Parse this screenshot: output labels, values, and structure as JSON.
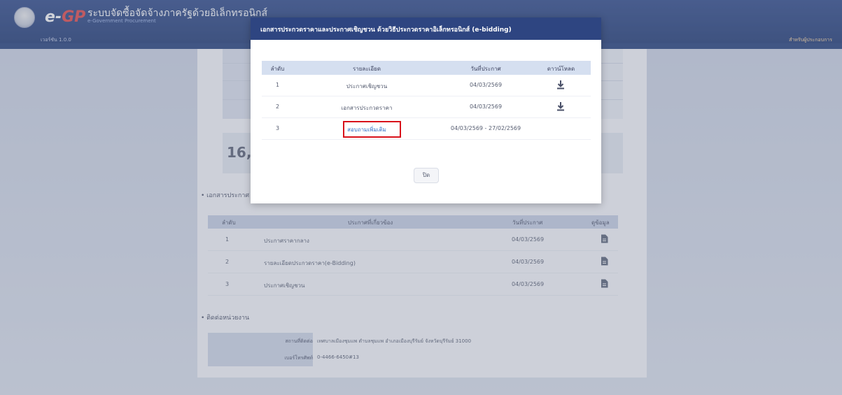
{
  "header": {
    "logo_prefix": "e-",
    "logo_suffix": "GP",
    "system_name": "ระบบจัดซื้อจัดจ้างภาครัฐด้วยอิเล็กทรอนิกส์",
    "sub_name": "e-Government Procurement",
    "version": "เวอร์ชัน 1.0.0",
    "right_link": "สำหรับผู้ประกอบการ"
  },
  "background": {
    "total_value": "16,",
    "section_announcements": "เอกสารประกาศ",
    "announcements_table": {
      "headers": [
        "ลำดับ",
        "ประกาศที่เกี่ยวข้อง",
        "วันที่ประกาศ",
        "ดูข้อมูล"
      ],
      "rows": [
        {
          "no": "1",
          "title": "ประกาศราคากลาง",
          "date": "04/03/2569"
        },
        {
          "no": "2",
          "title": "รายละเอียดประกวดราคา(e-Bidding)",
          "date": "04/03/2569"
        },
        {
          "no": "3",
          "title": "ประกาศเชิญชวน",
          "date": "04/03/2569"
        }
      ]
    },
    "section_agency": "ติดต่อหน่วยงาน",
    "agency": {
      "address_label": "สถานที่ติดต่อ",
      "address_value": "เทศบาลเมืองชุมแพ ตำบลชุมแพ อำเภอเมืองบุรีรัมย์ จังหวัดบุรีรัมย์ 31000",
      "phone_label": "เบอร์โทรศัพท์",
      "phone_value": "0-4466-6450#13"
    }
  },
  "modal": {
    "title": "เอกสารประกวดราคาและประกาศเชิญชวน ด้วยวิธีประกวดราคาอิเล็กทรอนิกส์ (e-bidding)",
    "table": {
      "headers": [
        "ลำดับ",
        "รายละเอียด",
        "วันที่ประกาศ",
        "ดาวน์โหลด"
      ],
      "rows": [
        {
          "no": "1",
          "desc": "ประกาศเชิญชวน",
          "date": "04/03/2569"
        },
        {
          "no": "2",
          "desc": "เอกสารประกวดราคา",
          "date": "04/03/2569"
        },
        {
          "no": "3",
          "desc": "สอบถามเพิ่มเติม",
          "date": "04/03/2569 - 27/02/2569"
        }
      ]
    },
    "close_label": "ปิด"
  },
  "colors": {
    "header_bg": "#2e4581",
    "highlight_border": "#d8121b",
    "link": "#3370c6"
  },
  "icons": {
    "download": "download-icon",
    "document": "document-icon"
  }
}
